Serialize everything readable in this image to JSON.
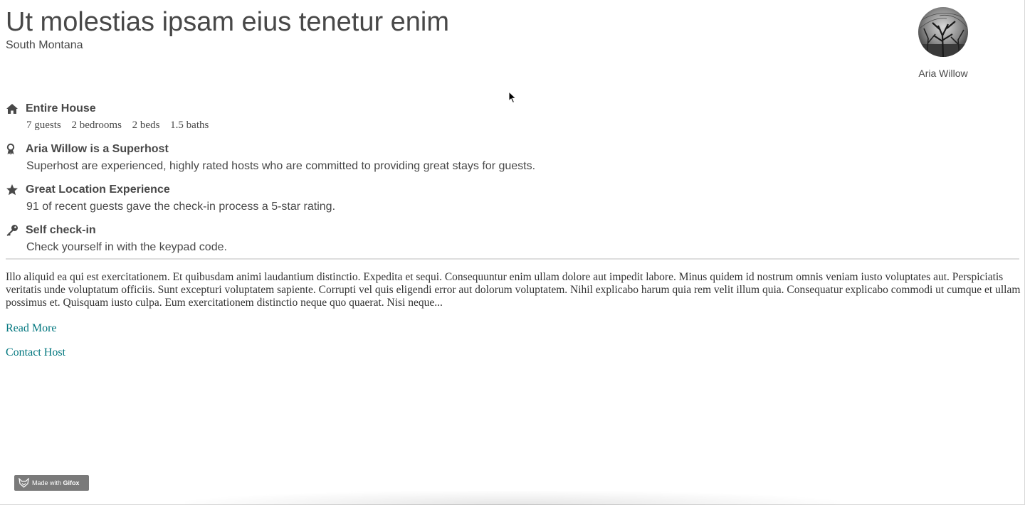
{
  "listing": {
    "title": "Ut molestias ipsam eius tenetur enim",
    "location": "South Montana"
  },
  "host": {
    "name": "Aria Willow",
    "avatar_icon": "host-avatar"
  },
  "features": {
    "house": {
      "icon": "home-icon",
      "title": "Entire House",
      "specs": [
        "7 guests",
        "2 bedrooms",
        "2 beds",
        "1.5 baths"
      ]
    },
    "superhost": {
      "icon": "award-icon",
      "title": "Aria Willow is a Superhost",
      "desc": "Superhost are experienced, highly rated hosts who are committed to providing great stays for guests."
    },
    "location": {
      "icon": "star-icon",
      "title": "Great Location Experience",
      "desc": "91 of recent guests gave the check-in process a 5-star rating."
    },
    "checkin": {
      "icon": "key-icon",
      "title": "Self check-in",
      "desc": "Check yourself in with the keypad code."
    }
  },
  "description": "Illo aliquid ea qui est exercitationem. Et quibusdam animi laudantium distinctio. Expedita et sequi. Consequuntur enim ullam dolore aut impedit labore. Minus quidem id nostrum omnis veniam iusto voluptates aut. Perspiciatis veritatis unde voluptatum officiis. Sunt excepturi voluptatem sapiente. Corrupti vel quis eligendi error aut dolorum voluptatem. Nihil explicabo harum quia rem velit illum quia. Consequatur explicabo commodi ut cumque et ullam possimus et. Quisquam iusto culpa. Eum exercitationem distinctio neque quo quaerat. Nisi neque...",
  "links": {
    "read_more": "Read More",
    "contact_host": "Contact Host"
  },
  "colors": {
    "text": "#484848",
    "link": "#00767e",
    "divider": "#dedede"
  },
  "watermark": {
    "prefix": "Made with",
    "brand": "Gifox"
  }
}
